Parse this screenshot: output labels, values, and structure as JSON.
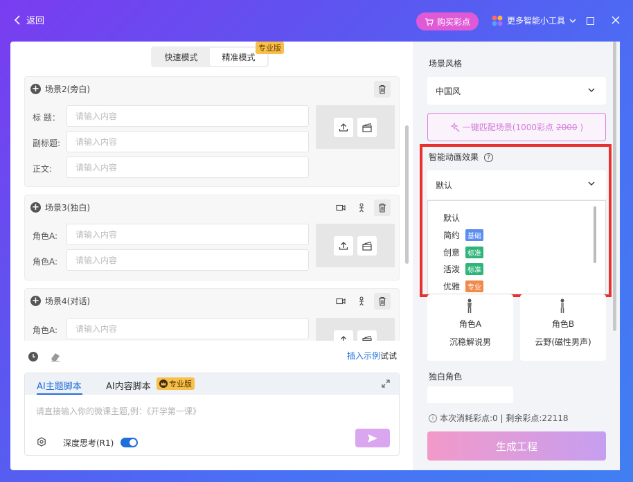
{
  "topbar": {
    "back_label": "返回",
    "buy_label": "购买彩点",
    "tools_label": "更多智能小工具"
  },
  "modes": {
    "fast": "快速模式",
    "precise": "精准模式",
    "pro_badge": "专业版"
  },
  "scenes": [
    {
      "title": "场景2(旁白)",
      "fields": [
        {
          "label": "标  题：",
          "placeholder": "请输入内容"
        },
        {
          "label": "副标题:",
          "placeholder": "请输入内容"
        },
        {
          "label": "正文:",
          "placeholder": "请输入内容"
        }
      ]
    },
    {
      "title": "场景3(独白)",
      "fields": [
        {
          "label": "角色A:",
          "placeholder": "请输入内容"
        },
        {
          "label": "角色A:",
          "placeholder": "请输入内容"
        }
      ]
    },
    {
      "title": "场景4(对话)",
      "fields": [
        {
          "label": "角色A:",
          "placeholder": "请输入内容"
        }
      ]
    }
  ],
  "insert": {
    "link": "插入示例",
    "suffix": "试试"
  },
  "ai_panel": {
    "tab_theme": "AI主题脚本",
    "tab_content": "AI内容脚本",
    "pro_badge": "专业版",
    "placeholder": "请直接输入你的微课主题,例：《开学第一课》",
    "deep_think": "深度思考(R1)"
  },
  "right": {
    "style_title": "场景风格",
    "style_value": "中国风",
    "match_label": "一键匹配场景(1000彩点",
    "match_original": "2000",
    "match_suffix": ")",
    "anim_title": "智能动画效果",
    "anim_value": "默认",
    "anim_options": [
      {
        "label": "默认",
        "tag": ""
      },
      {
        "label": "简约",
        "tag": "基础"
      },
      {
        "label": "创意",
        "tag": "标准"
      },
      {
        "label": "活泼",
        "tag": "标准"
      },
      {
        "label": "优雅",
        "tag": "专业"
      }
    ],
    "roles": [
      {
        "name": "角色A",
        "voice": "沉稳解说男"
      },
      {
        "name": "角色B",
        "voice": "云野(磁性男声)"
      }
    ],
    "mono_title": "独白角色",
    "cost_text": "本次消耗彩点:0 | 剩余彩点:22118",
    "generate_label": "生成工程"
  },
  "colors": {
    "accent_blue": "#1e6fd9",
    "pink": "#e05ad8",
    "highlight_red": "#e8312f",
    "tag_basic": "#5b8cf0",
    "tag_standard": "#2fb57a",
    "tag_pro": "#f08a4b"
  }
}
